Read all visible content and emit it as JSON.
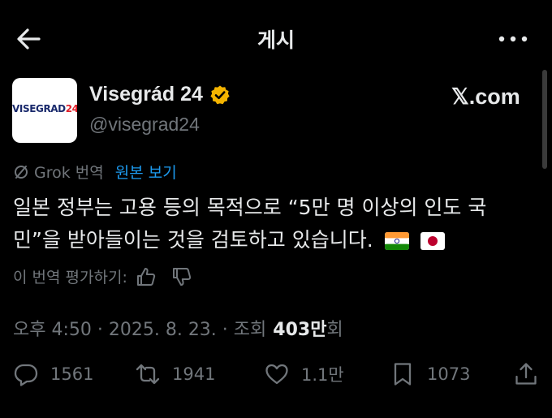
{
  "header": {
    "title": "게시",
    "back_icon": "arrow-left-icon",
    "more_icon": "more-horizontal-icon"
  },
  "author": {
    "avatar_text_part1": "VISEGRAD",
    "avatar_text_part2": "24",
    "name": "Visegrád 24",
    "handle": "@visegrad24",
    "verified_icon": "verified-badge-icon",
    "verified_color": "#f4b400"
  },
  "brand": "𝕏.com",
  "translation": {
    "grok_label": "Grok 번역",
    "view_original": "원본 보기"
  },
  "post": {
    "text_line1": "일본 정부는 고용 등의 목적으로 “5만 명 이상의 인도 국",
    "text_line2": "민”을 받아들이는 것을 검토하고 있습니다.",
    "flags": [
      "india-flag-icon",
      "japan-flag-icon"
    ]
  },
  "rating": {
    "label": "이 번역 평가하기:",
    "like_icon": "thumbs-up-icon",
    "dislike_icon": "thumbs-down-icon"
  },
  "meta": {
    "time": "오후 4:50 · 2025. 8. 23. · 조회",
    "views": "403만",
    "views_suffix": "회"
  },
  "actions": {
    "replies": "1561",
    "reposts": "1941",
    "likes": "1.1만",
    "bookmarks": "1073"
  },
  "colors": {
    "background": "#000000",
    "text": "#e7e9ea",
    "muted": "#71767b",
    "link": "#1d9bf0"
  }
}
